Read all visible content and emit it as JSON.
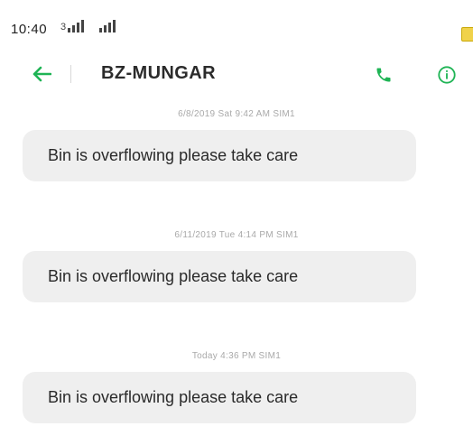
{
  "status_bar": {
    "time": "10:40",
    "signal_bars": [
      4,
      4
    ],
    "sim_label": "3"
  },
  "header": {
    "contact_name": "BZ-MUNGAR",
    "accent_color": "#1fb455"
  },
  "messages": [
    {
      "meta": "6/8/2019 Sat 9:42 AM SIM1",
      "text": "Bin is overflowing please take care"
    },
    {
      "meta": "6/11/2019 Tue 4:14 PM SIM1",
      "text": "Bin is overflowing please take care"
    },
    {
      "meta": "Today 4:36 PM SIM1",
      "text": "Bin is overflowing please take care"
    }
  ]
}
